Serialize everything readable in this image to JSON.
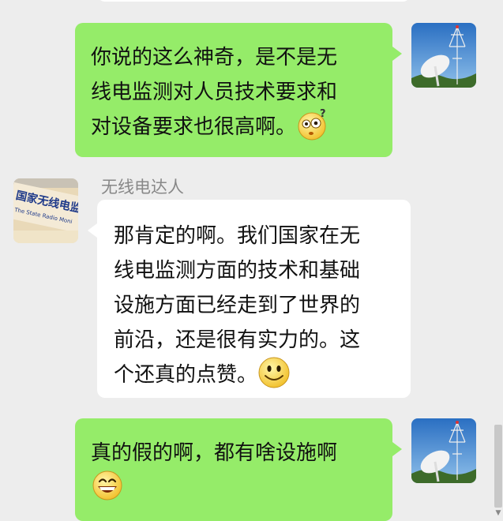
{
  "messages": [
    {
      "side": "right",
      "text": "你说的这么神奇，是不是无\n线电监测对人员技术要求和\n对设备要求也很高啊。",
      "emoji": "confused-face"
    },
    {
      "side": "left",
      "sender": "无线电达人",
      "text": "那肯定的啊。我们国家在无\n线电监测方面的技术和基础\n设施方面已经走到了世界的\n前沿，还是很有实力的。这\n个还真的点赞。",
      "emoji": "smile-face"
    },
    {
      "side": "right",
      "text": "真的假的啊，都有啥设施啊\n",
      "emoji": "grin-face"
    }
  ],
  "avatars": {
    "me": "satellite-dish-avatar",
    "other": "radio-agency-sign-avatar"
  },
  "avatar_other_sign": {
    "line1": "国家无线电监",
    "line2": "The State Radio Moni"
  },
  "colors": {
    "background": "#ededed",
    "my_bubble": "#95ec69",
    "other_bubble": "#ffffff",
    "sender_name": "#888888"
  }
}
